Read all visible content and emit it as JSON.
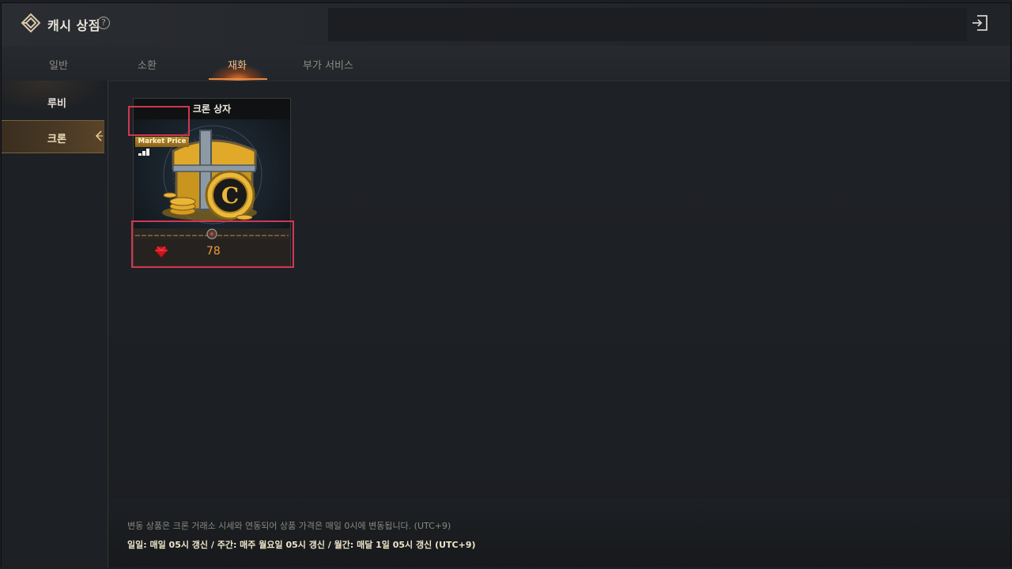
{
  "header": {
    "title": "캐시 상점",
    "help_icon": "?",
    "logo_icon": "shop-emblem-icon",
    "exit_icon": "exit-icon"
  },
  "tabs": [
    {
      "label": "일반",
      "active": false
    },
    {
      "label": "소환",
      "active": false
    },
    {
      "label": "재화",
      "active": true
    },
    {
      "label": "부가 서비스",
      "active": false
    }
  ],
  "sidebar": {
    "items": [
      {
        "label": "루비",
        "active": false
      },
      {
        "label": "크론",
        "active": true
      }
    ]
  },
  "products": [
    {
      "name": "크론 상자",
      "badge": "Market Price",
      "currency_icon": "ruby-icon",
      "price": "78"
    }
  ],
  "footer": {
    "note": "변동 상품은 크론 거래소 시세와 연동되어 상품 가격은 매일 0시에 변동됩니다. (UTC+9)",
    "refresh": "일일: 매일 05시 갱신 / 주간: 매주 월요일 05시 갱신 / 월간: 매달 1일 05시 갱신 (UTC+9)"
  },
  "colors": {
    "accent": "#f39a3c",
    "highlight": "#d1374f",
    "tab_active": "#f0c48a"
  }
}
